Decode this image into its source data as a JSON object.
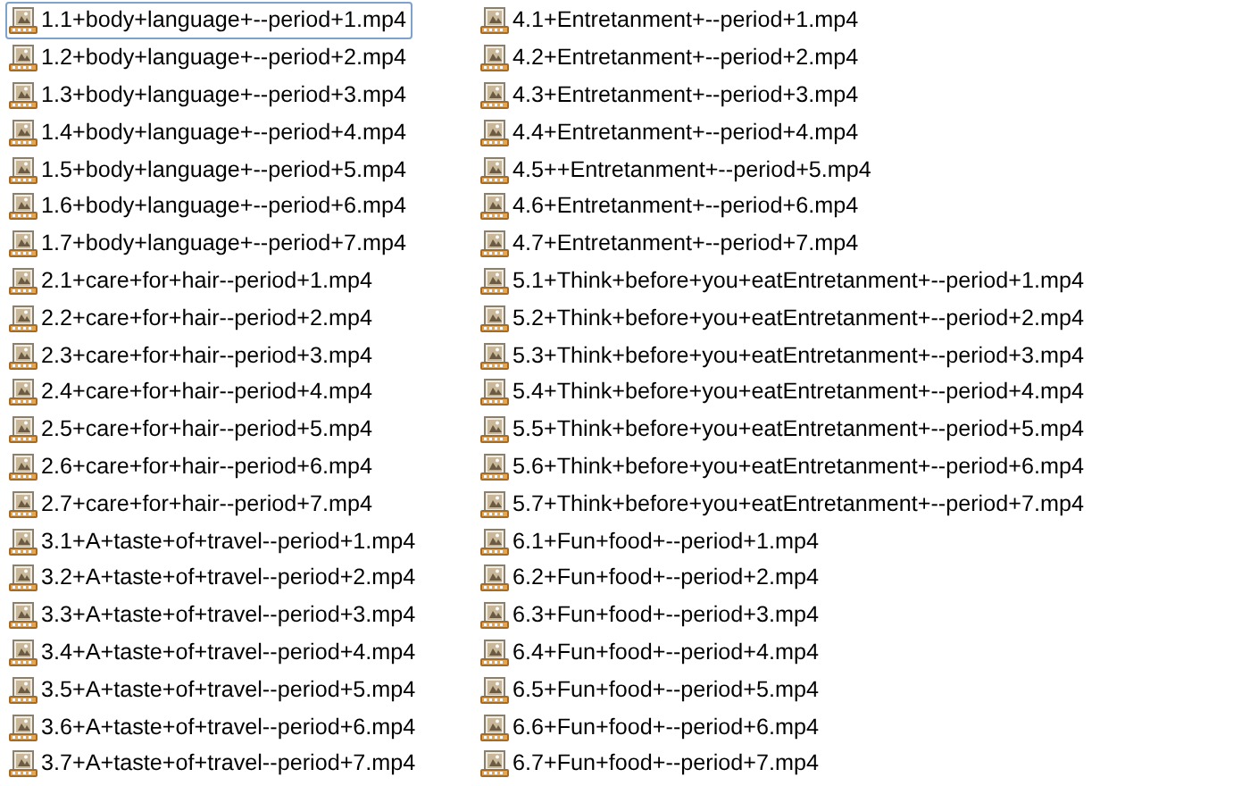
{
  "files": [
    {
      "name": "1.1+body+language+--period+1.mp4",
      "selected": true
    },
    {
      "name": "1.2+body+language+--period+2.mp4",
      "selected": false
    },
    {
      "name": "1.3+body+language+--period+3.mp4",
      "selected": false
    },
    {
      "name": "1.4+body+language+--period+4.mp4",
      "selected": false
    },
    {
      "name": "1.5+body+language+--period+5.mp4",
      "selected": false
    },
    {
      "name": "1.6+body+language+--period+6.mp4",
      "selected": false
    },
    {
      "name": "1.7+body+language+--period+7.mp4",
      "selected": false
    },
    {
      "name": "2.1+care+for+hair--period+1.mp4",
      "selected": false
    },
    {
      "name": "2.2+care+for+hair--period+2.mp4",
      "selected": false
    },
    {
      "name": "2.3+care+for+hair--period+3.mp4",
      "selected": false
    },
    {
      "name": "2.4+care+for+hair--period+4.mp4",
      "selected": false
    },
    {
      "name": "2.5+care+for+hair--period+5.mp4",
      "selected": false
    },
    {
      "name": "2.6+care+for+hair--period+6.mp4",
      "selected": false
    },
    {
      "name": "2.7+care+for+hair--period+7.mp4",
      "selected": false
    },
    {
      "name": "3.1+A+taste+of+travel--period+1.mp4",
      "selected": false
    },
    {
      "name": "3.2+A+taste+of+travel--period+2.mp4",
      "selected": false
    },
    {
      "name": "3.3+A+taste+of+travel--period+3.mp4",
      "selected": false
    },
    {
      "name": "3.4+A+taste+of+travel--period+4.mp4",
      "selected": false
    },
    {
      "name": "3.5+A+taste+of+travel--period+5.mp4",
      "selected": false
    },
    {
      "name": "3.6+A+taste+of+travel--period+6.mp4",
      "selected": false
    },
    {
      "name": "3.7+A+taste+of+travel--period+7.mp4",
      "selected": false
    },
    {
      "name": "4.1+Entretanment+--period+1.mp4",
      "selected": false
    },
    {
      "name": "4.2+Entretanment+--period+2.mp4",
      "selected": false
    },
    {
      "name": "4.3+Entretanment+--period+3.mp4",
      "selected": false
    },
    {
      "name": "4.4+Entretanment+--period+4.mp4",
      "selected": false
    },
    {
      "name": "4.5++Entretanment+--period+5.mp4",
      "selected": false
    },
    {
      "name": "4.6+Entretanment+--period+6.mp4",
      "selected": false
    },
    {
      "name": "4.7+Entretanment+--period+7.mp4",
      "selected": false
    },
    {
      "name": "5.1+Think+before+you+eatEntretanment+--period+1.mp4",
      "selected": false
    },
    {
      "name": "5.2+Think+before+you+eatEntretanment+--period+2.mp4",
      "selected": false
    },
    {
      "name": "5.3+Think+before+you+eatEntretanment+--period+3.mp4",
      "selected": false
    },
    {
      "name": "5.4+Think+before+you+eatEntretanment+--period+4.mp4",
      "selected": false
    },
    {
      "name": "5.5+Think+before+you+eatEntretanment+--period+5.mp4",
      "selected": false
    },
    {
      "name": "5.6+Think+before+you+eatEntretanment+--period+6.mp4",
      "selected": false
    },
    {
      "name": "5.7+Think+before+you+eatEntretanment+--period+7.mp4",
      "selected": false
    },
    {
      "name": "6.1+Fun+food+--period+1.mp4",
      "selected": false
    },
    {
      "name": "6.2+Fun+food+--period+2.mp4",
      "selected": false
    },
    {
      "name": "6.3+Fun+food+--period+3.mp4",
      "selected": false
    },
    {
      "name": "6.4+Fun+food+--period+4.mp4",
      "selected": false
    },
    {
      "name": "6.5+Fun+food+--period+5.mp4",
      "selected": false
    },
    {
      "name": "6.6+Fun+food+--period+6.mp4",
      "selected": false
    },
    {
      "name": "6.7+Fun+food+--period+7.mp4",
      "selected": false
    }
  ]
}
